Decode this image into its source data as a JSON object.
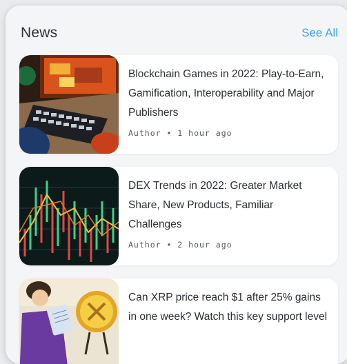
{
  "header": {
    "title": "News",
    "see_all_label": "See All"
  },
  "articles": [
    {
      "title": "Blockchain Games in 2022: Play-to-Earn, Gamification, Interoperability and Major Publishers",
      "meta": "Author • 1 hour ago",
      "thumbnail_icon": "gaming-keyboard-image"
    },
    {
      "title": "DEX Trends in 2022: Greater Market Share, New Products, Familiar Challenges",
      "meta": "Author • 2 hour ago",
      "thumbnail_icon": "trading-chart-image"
    },
    {
      "title": "Can XRP price reach $1 after 25% gains in one week? Watch this key support level",
      "meta": "",
      "thumbnail_icon": "xrp-coin-image"
    }
  ],
  "colors": {
    "accent": "#3ea6e6",
    "panel": "#f4f5f7",
    "card": "#ffffff",
    "text": "#2a2d33"
  }
}
